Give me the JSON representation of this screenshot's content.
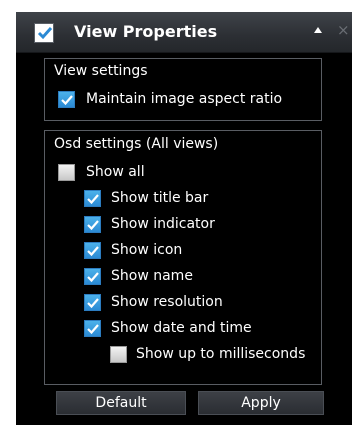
{
  "header": {
    "title": "View Properties",
    "checked": true
  },
  "view_settings": {
    "title": "View settings",
    "items": [
      {
        "label": "Maintain image aspect ratio",
        "checked": true
      }
    ]
  },
  "osd_settings": {
    "title": "Osd settings (All views)",
    "items": [
      {
        "label": "Show all",
        "checked": false
      },
      {
        "label": "Show title bar",
        "checked": true
      },
      {
        "label": "Show indicator",
        "checked": true
      },
      {
        "label": "Show icon",
        "checked": true
      },
      {
        "label": "Show name",
        "checked": true
      },
      {
        "label": "Show resolution",
        "checked": true
      },
      {
        "label": "Show date and time",
        "checked": true
      },
      {
        "label": "Show up to milliseconds",
        "checked": false
      }
    ]
  },
  "buttons": {
    "default_label": "Default",
    "apply_label": "Apply"
  },
  "colors": {
    "panel_bg": "#000000",
    "checkbox_checked": "#2b8ad4",
    "text": "#ffffff"
  }
}
